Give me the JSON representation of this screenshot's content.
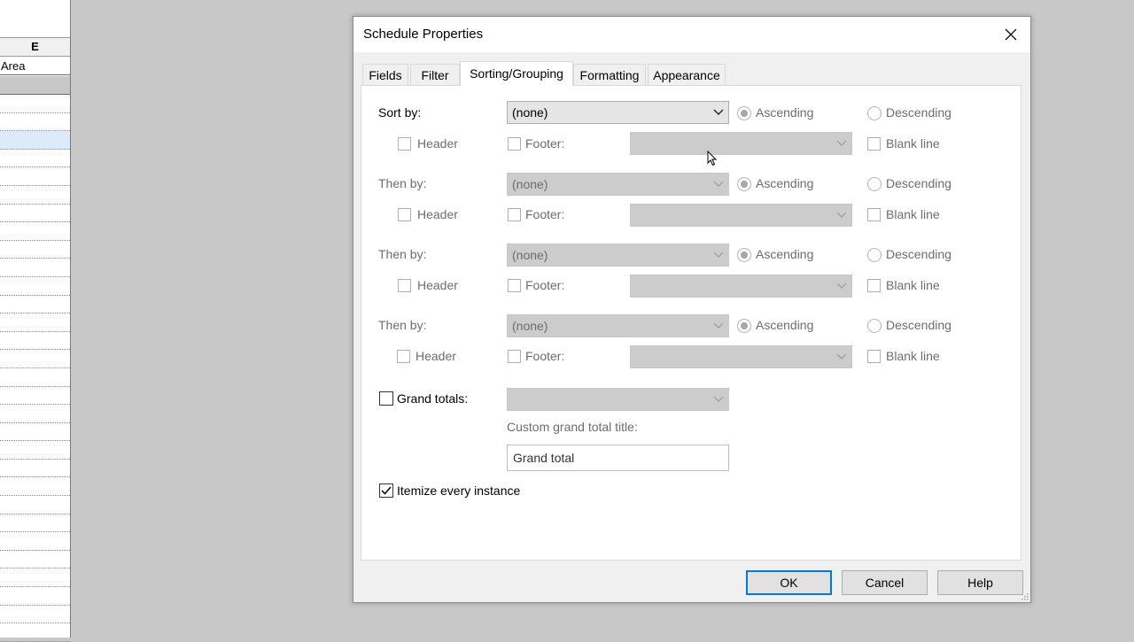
{
  "sheet": {
    "column_header": "E",
    "field_header": "Area"
  },
  "dialog": {
    "title": "Schedule Properties",
    "tabs": [
      {
        "label": "Fields",
        "active": false
      },
      {
        "label": "Filter",
        "active": false
      },
      {
        "label": "Sorting/Grouping",
        "active": true
      },
      {
        "label": "Formatting",
        "active": false
      },
      {
        "label": "Appearance",
        "active": false
      }
    ],
    "sort_groups": [
      {
        "label": "Sort by:",
        "value": "(none)",
        "ascending": "Ascending",
        "descending": "Descending",
        "header": "Header",
        "footer": "Footer:",
        "blank_line": "Blank line",
        "enabled": true
      },
      {
        "label": "Then by:",
        "value": "(none)",
        "ascending": "Ascending",
        "descending": "Descending",
        "header": "Header",
        "footer": "Footer:",
        "blank_line": "Blank line",
        "enabled": false
      },
      {
        "label": "Then by:",
        "value": "(none)",
        "ascending": "Ascending",
        "descending": "Descending",
        "header": "Header",
        "footer": "Footer:",
        "blank_line": "Blank line",
        "enabled": false
      },
      {
        "label": "Then by:",
        "value": "(none)",
        "ascending": "Ascending",
        "descending": "Descending",
        "header": "Header",
        "footer": "Footer:",
        "blank_line": "Blank line",
        "enabled": false
      }
    ],
    "grand_totals": {
      "label": "Grand totals:",
      "checked": false,
      "value": ""
    },
    "custom_title": {
      "label": "Custom grand total title:",
      "value": "Grand total"
    },
    "itemize": {
      "label": "Itemize every instance",
      "checked": true
    },
    "buttons": {
      "ok": "OK",
      "cancel": "Cancel",
      "help": "Help"
    }
  },
  "colors": {
    "accent": "#0078d7",
    "disabled_text": "#6d6d6d",
    "selected_row": "#dcebf9"
  },
  "icons": {
    "close": "close-icon",
    "dropdown": "chevron-down-icon",
    "check": "check-icon",
    "cursor": "mouse-pointer-icon",
    "grip": "resize-grip-icon"
  }
}
